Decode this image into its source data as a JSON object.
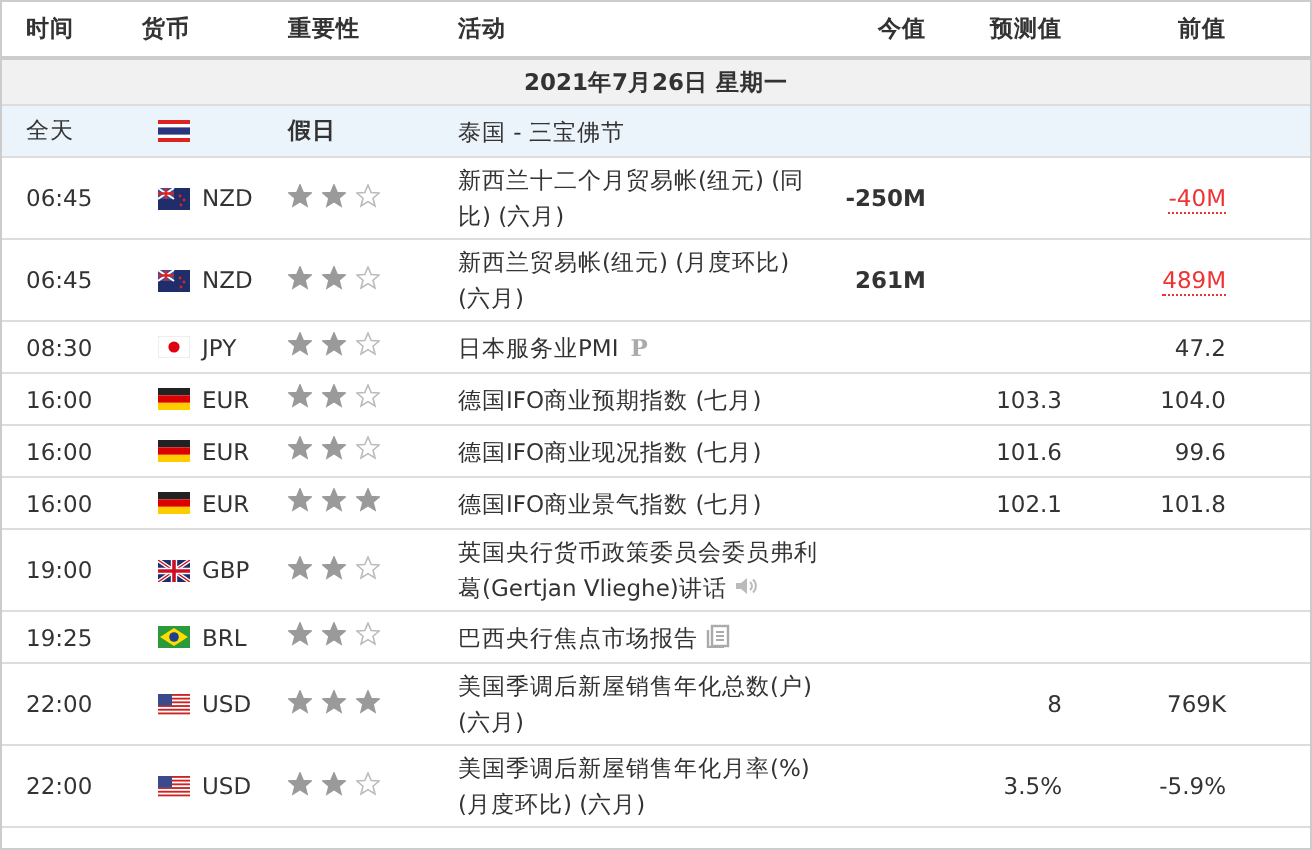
{
  "columns": [
    "时间",
    "货币",
    "重要性",
    "活动",
    "今值",
    "预测值",
    "前值"
  ],
  "date_row": "2021年7月26日  星期一",
  "rows": [
    {
      "kind": "holiday",
      "time": "全天",
      "importance": "假日",
      "event": "泰国 - 三宝佛节"
    },
    {
      "kind": "event",
      "time": "06:45",
      "currency": "NZD",
      "stars": 2,
      "event": "新西兰十二个月贸易帐(纽元) (同比) (六月)",
      "actual": "-250M",
      "previous": "-40M",
      "revised": true
    },
    {
      "kind": "event",
      "time": "06:45",
      "currency": "NZD",
      "stars": 2,
      "event": "新西兰贸易帐(纽元) (月度环比) (六月)",
      "actual": "261M",
      "previous": "489M",
      "revised": true
    },
    {
      "kind": "event",
      "time": "08:30",
      "currency": "JPY",
      "stars": 2,
      "event": "日本服务业PMI",
      "badge": "P",
      "previous": "47.2",
      "revised": false
    },
    {
      "kind": "event",
      "time": "16:00",
      "currency": "EUR",
      "stars": 2,
      "event": "德国IFO商业预期指数 (七月)",
      "forecast": "103.3",
      "previous": "104.0",
      "revised": false
    },
    {
      "kind": "event",
      "time": "16:00",
      "currency": "EUR",
      "stars": 2,
      "event": "德国IFO商业现况指数 (七月)",
      "forecast": "101.6",
      "previous": "99.6",
      "revised": false
    },
    {
      "kind": "event",
      "time": "16:00",
      "currency": "EUR",
      "stars": 3,
      "event": "德国IFO商业景气指数 (七月)",
      "forecast": "102.1",
      "previous": "101.8",
      "revised": false
    },
    {
      "kind": "event",
      "time": "19:00",
      "currency": "GBP",
      "stars": 2,
      "event": "英国央行货币政策委员会委员弗利葛(Gertjan Vlieghe)讲话"
    },
    {
      "kind": "event",
      "time": "19:25",
      "currency": "BRL",
      "stars": 2,
      "event": "巴西央行焦点市场报告"
    },
    {
      "kind": "event",
      "time": "22:00",
      "currency": "USD",
      "stars": 3,
      "event": "美国季调后新屋销售年化总数(户) (六月)",
      "forecast": "8",
      "previous": "769K",
      "revised": false
    },
    {
      "kind": "event",
      "time": "22:00",
      "currency": "USD",
      "stars": 2,
      "event": "美国季调后新屋销售年化月率(%) (月度环比) (六月)",
      "forecast": "3.5%",
      "previous": "-5.9%",
      "revised": false
    }
  ]
}
